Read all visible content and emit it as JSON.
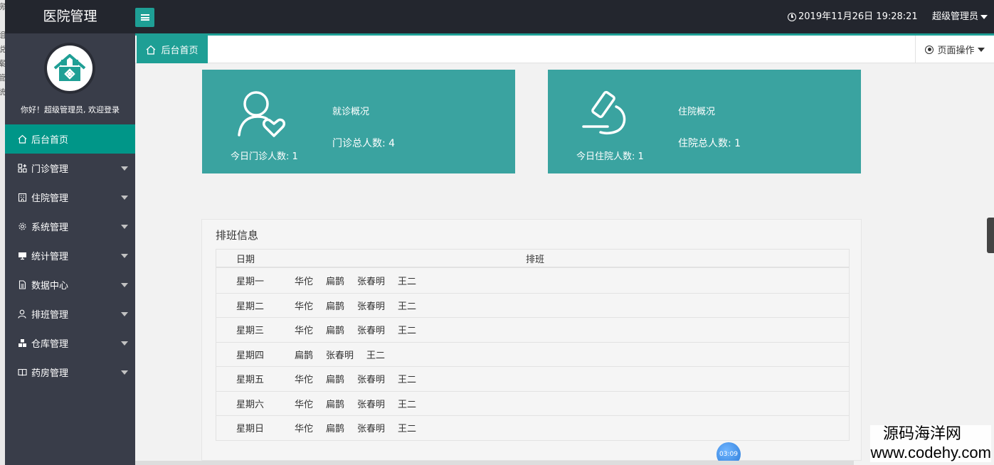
{
  "left_strip": [
    "房",
    "i",
    "组",
    "说",
    "案",
    "管",
    "统"
  ],
  "header": {
    "brand": "医院管理",
    "datetime": "2019年11月26日 19:28:21",
    "user": "超级管理员"
  },
  "sidebar": {
    "welcome": "你好！超级管理员, 欢迎登录",
    "items": [
      {
        "label": "后台首页",
        "icon": "home-icon"
      },
      {
        "label": "门诊管理",
        "icon": "grid-icon"
      },
      {
        "label": "住院管理",
        "icon": "building-icon"
      },
      {
        "label": "系统管理",
        "icon": "gear-icon"
      },
      {
        "label": "统计管理",
        "icon": "monitor-icon"
      },
      {
        "label": "数据中心",
        "icon": "file-icon"
      },
      {
        "label": "排班管理",
        "icon": "user-icon"
      },
      {
        "label": "仓库管理",
        "icon": "boxes-icon"
      },
      {
        "label": "药房管理",
        "icon": "book-icon"
      }
    ]
  },
  "tabs": {
    "home": "后台首页",
    "page_ops": "页面操作"
  },
  "cards": {
    "outpatient": {
      "title": "就诊概况",
      "today": "今日门诊人数: 1",
      "total": "门诊总人数: 4"
    },
    "inpatient": {
      "title": "住院概况",
      "today": "今日住院人数: 1",
      "total": "住院总人数: 1"
    }
  },
  "schedule": {
    "title": "排班信息",
    "col_date": "日期",
    "col_shift": "排班",
    "rows": [
      {
        "day": "星期一",
        "doctors": [
          "华佗",
          "扁鹊",
          "张春明",
          "王二"
        ]
      },
      {
        "day": "星期二",
        "doctors": [
          "华佗",
          "扁鹊",
          "张春明",
          "王二"
        ]
      },
      {
        "day": "星期三",
        "doctors": [
          "华佗",
          "扁鹊",
          "张春明",
          "王二"
        ]
      },
      {
        "day": "星期四",
        "doctors": [
          "扁鹊",
          "张春明",
          "王二"
        ]
      },
      {
        "day": "星期五",
        "doctors": [
          "华佗",
          "扁鹊",
          "张春明",
          "王二"
        ]
      },
      {
        "day": "星期六",
        "doctors": [
          "华佗",
          "扁鹊",
          "张春明",
          "王二"
        ]
      },
      {
        "day": "星期日",
        "doctors": [
          "华佗",
          "扁鹊",
          "张春明",
          "王二"
        ]
      }
    ]
  },
  "timer": "03:09",
  "watermark": {
    "cn": "源码海洋网",
    "en": "www.codehy.com"
  },
  "colors": {
    "accent": "#1e9f95",
    "card": "#3aa3a0",
    "sidebar": "#393d49",
    "header": "#23262e"
  }
}
